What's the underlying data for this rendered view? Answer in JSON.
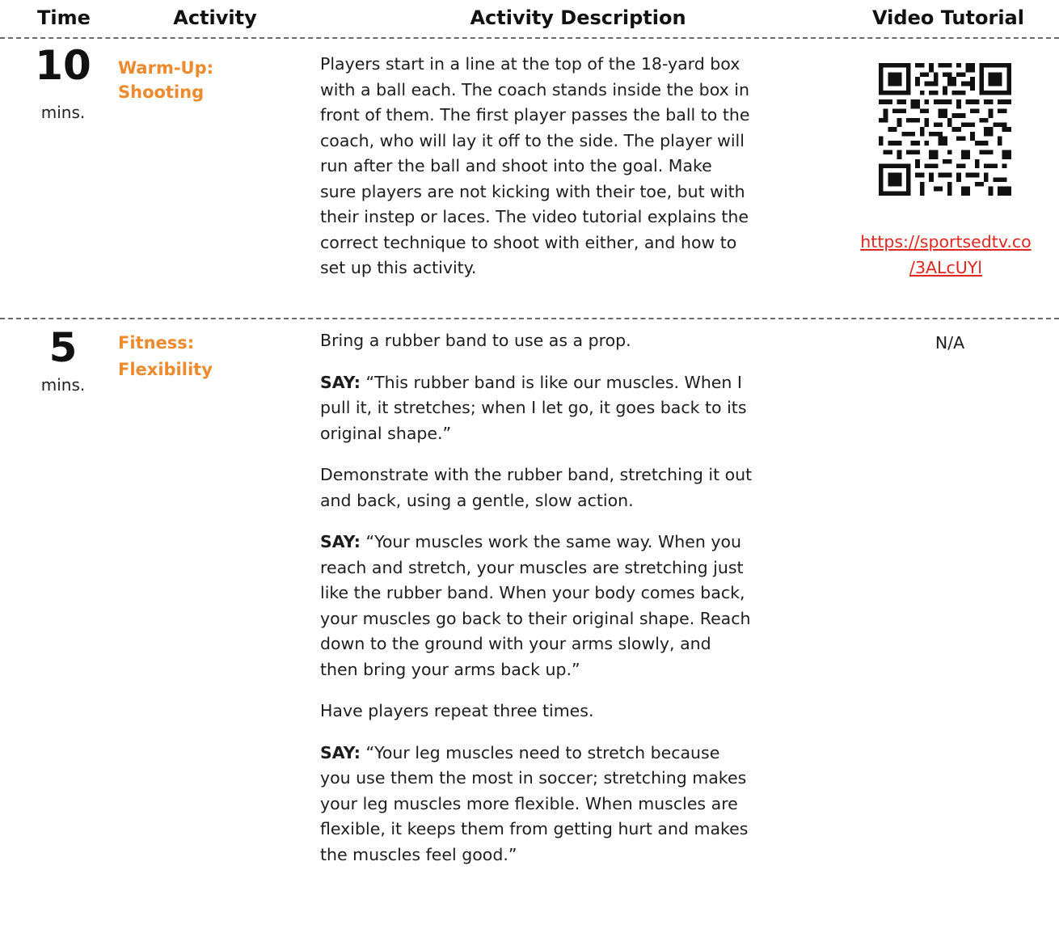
{
  "header": {
    "time": "Time",
    "activity": "Activity",
    "description": "Activity Description",
    "video": "Video Tutorial"
  },
  "rows": [
    {
      "time_value": "10",
      "time_unit": "mins.",
      "activity_line1": "Warm-Up:",
      "activity_line2": "Shooting",
      "description": [
        "Players start in a line at the top of the 18-yard box",
        "with a ball each. The coach stands inside the box in",
        "front of them. The first player passes the ball to the",
        "coach, who will lay it off to the side. The player will",
        "run after the ball and shoot into the goal. Make",
        "sure players are not kicking with their toe, but with",
        "their instep or laces. The video tutorial explains the",
        "correct technique to shoot with either, and how to",
        "set up this activity."
      ],
      "video_link_line1": "https://sportsedtv.co",
      "video_link_line2": "/3ALcUYl",
      "qr_icon": "qr-code-icon"
    },
    {
      "time_value": "5",
      "time_unit": "mins.",
      "activity_line1": "Fitness:",
      "activity_line2": "Flexibility",
      "video_text": "N/A",
      "paragraphs": [
        {
          "say": "",
          "lines": [
            "Bring a rubber band to use as a prop."
          ]
        },
        {
          "say": "SAY:",
          "lines": [
            " “This rubber band is like our muscles. When I",
            "pull it, it stretches; when I let go, it goes back to its",
            "original shape.”"
          ]
        },
        {
          "say": "",
          "lines": [
            "Demonstrate with the rubber band, stretching it out",
            "and back, using a gentle, slow action."
          ]
        },
        {
          "say": "SAY:",
          "lines": [
            " “Your muscles work the same way. When you",
            "reach and stretch, your muscles are stretching just",
            "like the rubber band. When your body comes back,",
            "your muscles go back to their original shape. Reach",
            "down to the ground with your arms slowly, and",
            "then bring your arms back up.”"
          ]
        },
        {
          "say": "",
          "lines": [
            "Have players repeat three times."
          ]
        },
        {
          "say": "SAY:",
          "lines": [
            " “Your leg muscles need to stretch because",
            "you use them the most in soccer; stretching makes",
            "your leg muscles more flexible. When muscles are",
            "flexible, it keeps them from getting hurt and makes",
            "the muscles feel good.”"
          ]
        }
      ]
    }
  ],
  "colors": {
    "activity_accent": "#ee8a2e",
    "link": "#e0261f"
  }
}
